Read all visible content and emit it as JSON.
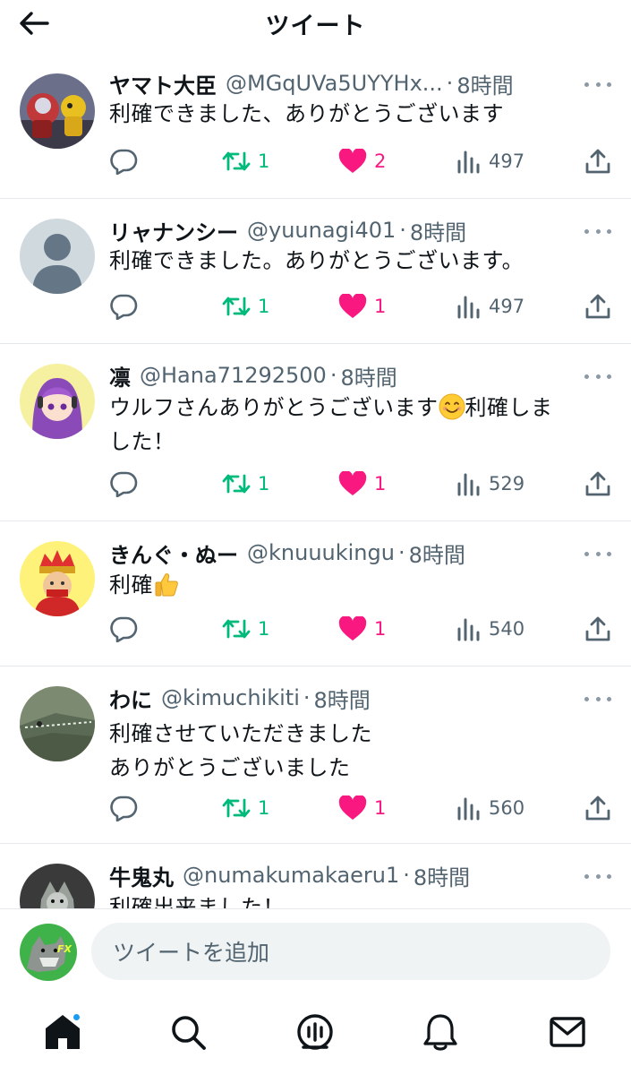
{
  "header": {
    "title": "ツイート"
  },
  "replies": [
    {
      "name": "ヤマト大臣",
      "handle": "@MGqUVa5UYYHx...",
      "time": "8時間",
      "text": "利確できました、ありがとうございます",
      "retweets": "1",
      "likes": "2",
      "views": "497"
    },
    {
      "name": "リャナンシー",
      "handle": "@yuunagi401",
      "time": "8時間",
      "text": "利確できました。ありがとうございます。",
      "retweets": "1",
      "likes": "1",
      "views": "497"
    },
    {
      "name": "凛",
      "handle": "@Hana71292500",
      "time": "8時間",
      "text_before": "ウルフさんありがとうございます",
      "text_after": "利確しま\nした！",
      "emoji": "smiling-face-emoji",
      "retweets": "1",
      "likes": "1",
      "views": "529"
    },
    {
      "name": "きんぐ・ぬー",
      "handle": "@knuuukingu",
      "time": "8時間",
      "text": "利確",
      "emoji": "thumbs-up-emoji",
      "retweets": "1",
      "likes": "1",
      "views": "540"
    },
    {
      "name": "わに",
      "handle": "@kimuchikiti",
      "time": "8時間",
      "text": "利確させていただきました\nありがとうございました",
      "retweets": "1",
      "likes": "1",
      "views": "560"
    },
    {
      "name": "牛鬼丸",
      "handle": "@numakumakaeru1",
      "time": "8時間",
      "text": "利確出来ました！"
    }
  ],
  "composer": {
    "placeholder": "ツイートを追加",
    "avatar_badge": "FX"
  },
  "nav": [
    "home-icon",
    "search-icon",
    "spaces-icon",
    "notifications-icon",
    "messages-icon"
  ],
  "colors": {
    "retweet": "#00ba7c",
    "like": "#f91880",
    "muted": "#536471",
    "accent": "#1d9bf0"
  }
}
